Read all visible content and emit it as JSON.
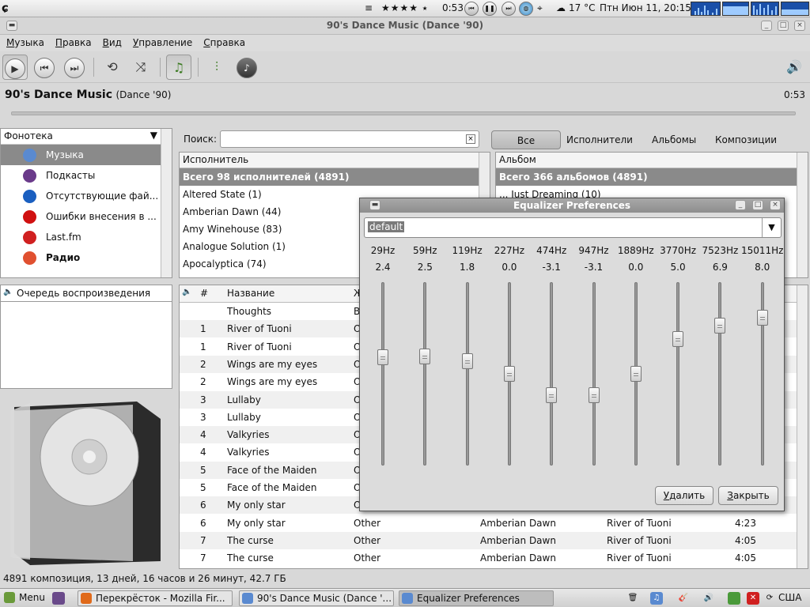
{
  "top_panel": {
    "rating": "★★★★ ⭑",
    "track_time": "0:53",
    "weather": "17 °C",
    "datetime": "Птн Июн 11, 20:15"
  },
  "window": {
    "title": "90's Dance Music (Dance '90)"
  },
  "menu": [
    {
      "u": "М",
      "rest": "узыка"
    },
    {
      "u": "П",
      "rest": "равка"
    },
    {
      "u": "В",
      "rest": "ид"
    },
    {
      "u": "У",
      "rest": "правление"
    },
    {
      "u": "С",
      "rest": "правка"
    }
  ],
  "now_playing": {
    "album_title": "90's Dance Music",
    "album_year": "(Dance '90)",
    "time": "0:53",
    "progress": 0.0
  },
  "library": {
    "title": "Фонотека",
    "items": [
      {
        "label": "Музыка",
        "icon": "music-note-icon",
        "color": "#5a8ad0"
      },
      {
        "label": "Подкасты",
        "icon": "podcast-icon",
        "color": "#6a3a8a"
      },
      {
        "label": "Отсутствующие фай...",
        "icon": "info-icon",
        "color": "#1a5fc0"
      },
      {
        "label": "Ошибки внесения в ...",
        "icon": "no-entry-icon",
        "color": "#d01010"
      },
      {
        "label": "Last.fm",
        "icon": "lastfm-icon",
        "color": "#d02020"
      },
      {
        "label": "Радио",
        "icon": "radio-icon",
        "color": "#e05030"
      }
    ]
  },
  "queue": {
    "title": "Очередь воспроизведения"
  },
  "search": {
    "label": "Поиск:",
    "value": ""
  },
  "filters": [
    "Все",
    "Исполнители",
    "Альбомы",
    "Композиции"
  ],
  "artists": {
    "header": "Исполнитель",
    "all": "Всего 98 исполнителей (4891)",
    "rows": [
      "Altered State (1)",
      "Amberian Dawn (44)",
      "Amy Winehouse (83)",
      "Analogue Solution (1)",
      "Apocalyptica (74)"
    ]
  },
  "albums": {
    "header": "Альбом",
    "all": "Всего 366 альбомов (4891)",
    "rows": [
      "... Just Dreaming (10)"
    ]
  },
  "tracks": {
    "headers": {
      "num": "#",
      "title": "Название",
      "genre": "Ж"
    },
    "rows": [
      {
        "num": "",
        "title": "Thoughts",
        "genre": "B",
        "artist": "",
        "album": "",
        "time": ""
      },
      {
        "num": "1",
        "title": "River of Tuoni",
        "genre": "O",
        "artist": "",
        "album": "",
        "time": ""
      },
      {
        "num": "1",
        "title": "River of Tuoni",
        "genre": "O",
        "artist": "",
        "album": "",
        "time": ""
      },
      {
        "num": "2",
        "title": "Wings are my eyes",
        "genre": "O",
        "artist": "",
        "album": "",
        "time": ""
      },
      {
        "num": "2",
        "title": "Wings are my eyes",
        "genre": "O",
        "artist": "",
        "album": "",
        "time": ""
      },
      {
        "num": "3",
        "title": "Lullaby",
        "genre": "O",
        "artist": "",
        "album": "",
        "time": ""
      },
      {
        "num": "3",
        "title": "Lullaby",
        "genre": "O",
        "artist": "",
        "album": "",
        "time": ""
      },
      {
        "num": "4",
        "title": "Valkyries",
        "genre": "O",
        "artist": "",
        "album": "",
        "time": ""
      },
      {
        "num": "4",
        "title": "Valkyries",
        "genre": "O",
        "artist": "",
        "album": "",
        "time": ""
      },
      {
        "num": "5",
        "title": "Face of the Maiden",
        "genre": "O",
        "artist": "",
        "album": "",
        "time": ""
      },
      {
        "num": "5",
        "title": "Face of the Maiden",
        "genre": "O",
        "artist": "",
        "album": "",
        "time": ""
      },
      {
        "num": "6",
        "title": "My only star",
        "genre": "O",
        "artist": "",
        "album": "",
        "time": ""
      },
      {
        "num": "6",
        "title": "My only star",
        "genre": "Other",
        "artist": "Amberian Dawn",
        "album": "River of Tuoni",
        "time": "4:23"
      },
      {
        "num": "7",
        "title": "The curse",
        "genre": "Other",
        "artist": "Amberian Dawn",
        "album": "River of Tuoni",
        "time": "4:05"
      },
      {
        "num": "7",
        "title": "The curse",
        "genre": "Other",
        "artist": "Amberian Dawn",
        "album": "River of Tuoni",
        "time": "4:05"
      }
    ]
  },
  "status": "4891 композиция, 13 дней, 16 часов и 26 минут, 42.7 ГБ",
  "equalizer": {
    "title": "Equalizer Preferences",
    "preset": "default",
    "gain_range": [
      -12,
      12
    ],
    "bands": [
      {
        "freq": "29Hz",
        "gain": "2.4"
      },
      {
        "freq": "59Hz",
        "gain": "2.5"
      },
      {
        "freq": "119Hz",
        "gain": "1.8"
      },
      {
        "freq": "227Hz",
        "gain": "0.0"
      },
      {
        "freq": "474Hz",
        "gain": "-3.1"
      },
      {
        "freq": "947Hz",
        "gain": "-3.1"
      },
      {
        "freq": "1889Hz",
        "gain": "0.0"
      },
      {
        "freq": "3770Hz",
        "gain": "5.0"
      },
      {
        "freq": "7523Hz",
        "gain": "6.9"
      },
      {
        "freq": "15011Hz",
        "gain": "8.0"
      }
    ],
    "delete_label": "Удалить",
    "close_label": "Закрыть",
    "delete_u": "У",
    "delete_rest": "далить",
    "close_u": "З",
    "close_rest": "акрыть"
  },
  "taskbar": {
    "menu_label": "Menu",
    "tasks": [
      {
        "label": "Перекрёсток - Mozilla Fir...",
        "color": "#e06a1a"
      },
      {
        "label": "90's Dance Music (Dance '...",
        "color": "#5a8ad0"
      },
      {
        "label": "Equalizer Preferences",
        "color": "#5a8ad0"
      }
    ],
    "keyboard": "США"
  }
}
